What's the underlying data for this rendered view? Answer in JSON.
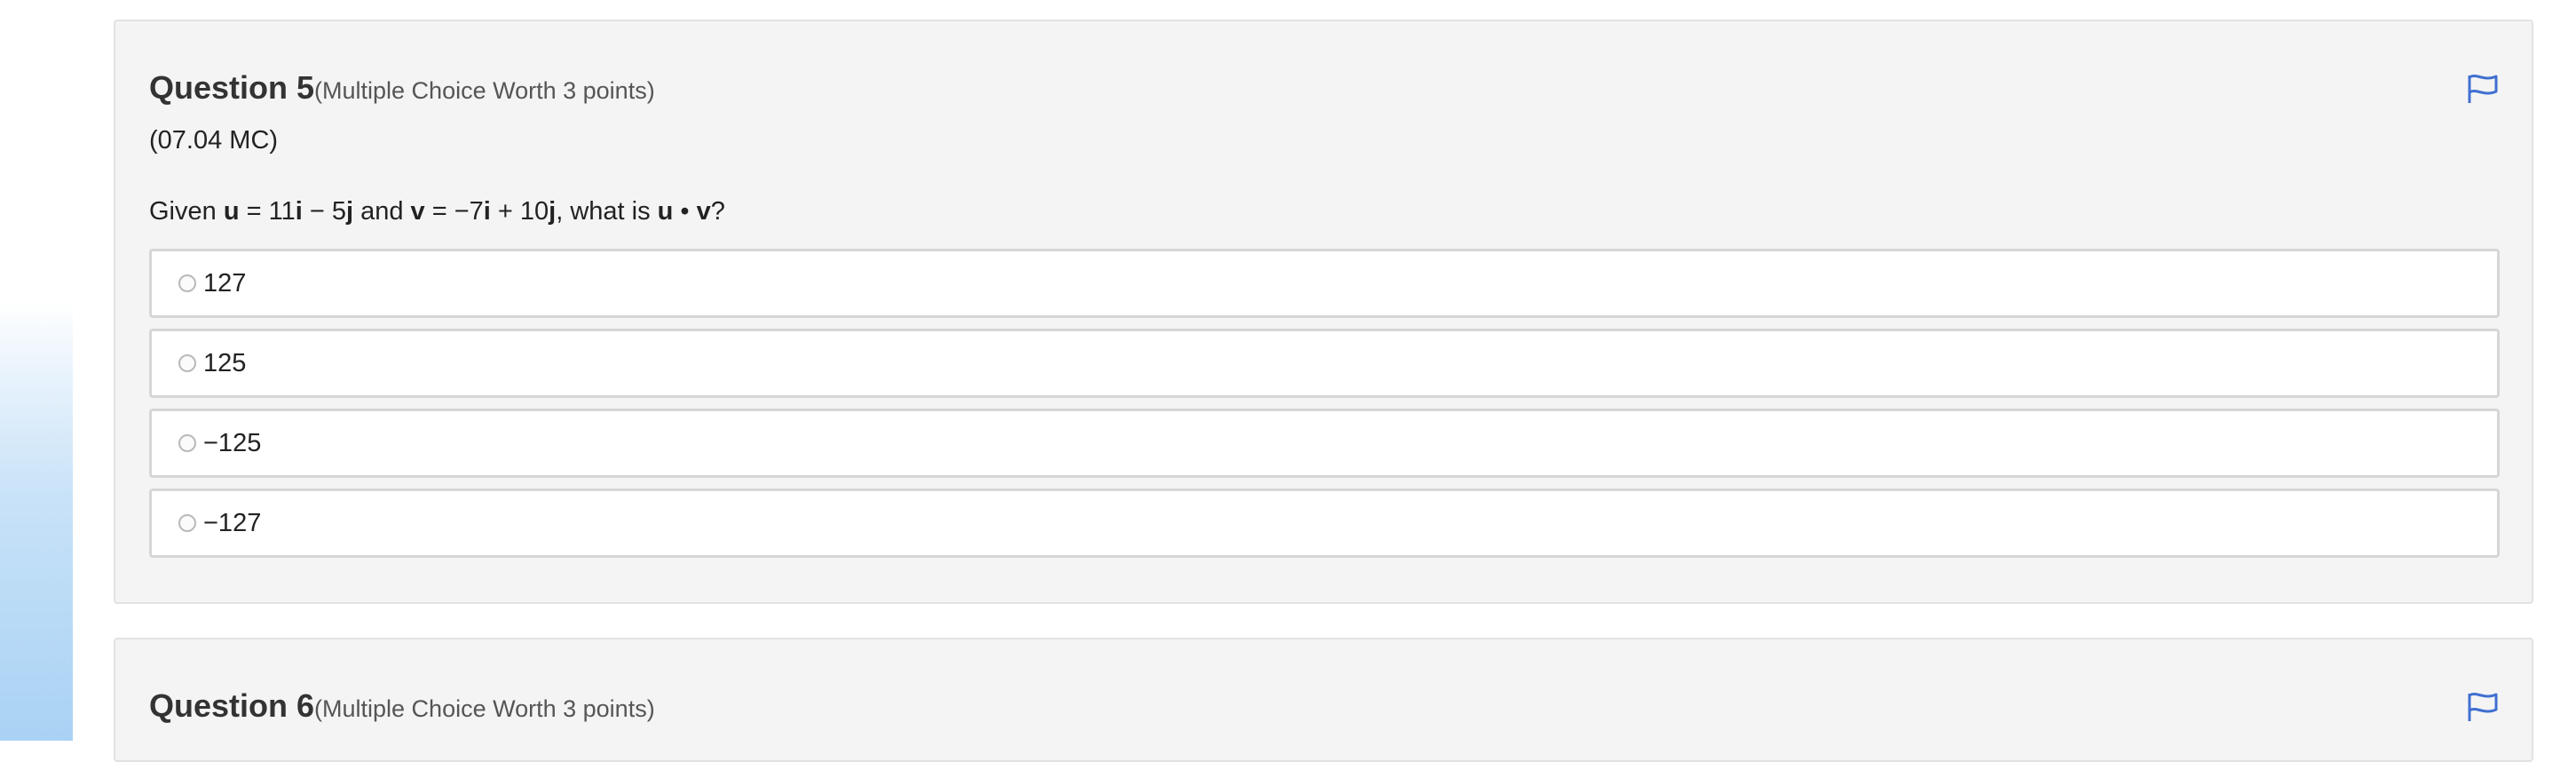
{
  "questions": [
    {
      "title": "Question 5",
      "worth": "(Multiple Choice Worth 3 points)",
      "code": "(07.04 MC)",
      "prompt": {
        "t1": "Given ",
        "b1": "u",
        "t2": " = 11",
        "b2": "i",
        "t3": " − 5",
        "b3": "j",
        "t4": " and ",
        "b4": "v",
        "t5": " = −7",
        "b5": "i",
        "t6": " + 10",
        "b6": "j",
        "t7": ", what is ",
        "b7": "u",
        "t8": " • ",
        "b8": "v",
        "t9": "?"
      },
      "options": [
        "127",
        "125",
        "−125",
        "−127"
      ],
      "flag_icon": "flag-icon"
    },
    {
      "title": "Question 6",
      "worth": "(Multiple Choice Worth 3 points)",
      "flag_icon": "flag-icon"
    }
  ],
  "colors": {
    "card_background": "#f4f4f4",
    "flag": "#3f6fd1",
    "side_gradient": "#a9d2f4"
  }
}
